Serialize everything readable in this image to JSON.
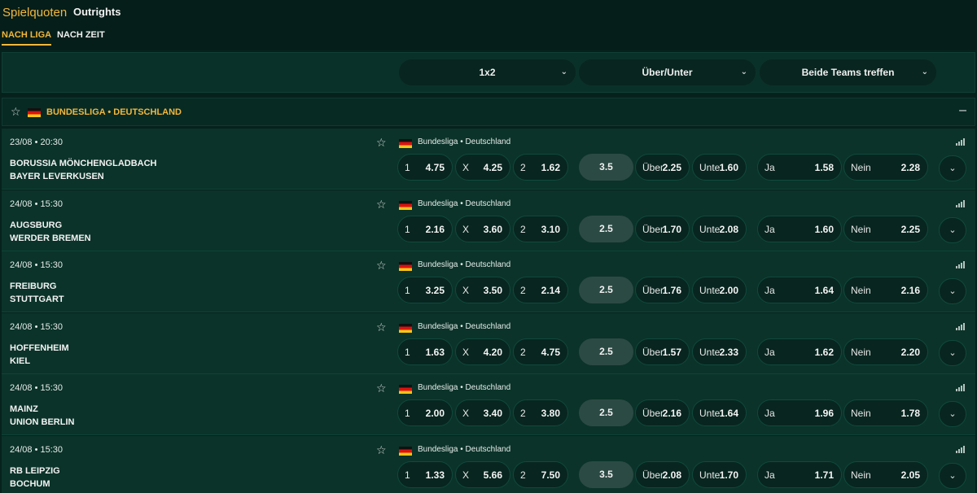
{
  "nav": {
    "tab_odds": "Spielquoten",
    "tab_outrights": "Outrights",
    "sub_by_league": "NACH LIGA",
    "sub_by_time": "NACH ZEIT"
  },
  "markets": [
    {
      "label": "1x2"
    },
    {
      "label": "Über/Unter"
    },
    {
      "label": "Beide Teams treffen"
    }
  ],
  "league": {
    "name": "BUNDESLIGA • DEUTSCHLAND",
    "collapse": "–"
  },
  "labels": {
    "one": "1",
    "x": "X",
    "two": "2",
    "over": "Über",
    "under": "Unte",
    "yes": "Ja",
    "no": "Nein"
  },
  "matches": [
    {
      "date": "23/08 • 20:30",
      "home": "BORUSSIA MÖNCHENGLADBACH",
      "away": "BAYER LEVERKUSEN",
      "league": "Bundesliga • Deutschland",
      "o1": "4.75",
      "ox": "4.25",
      "o2": "1.62",
      "line": "3.5",
      "over": "2.25",
      "under": "1.60",
      "yes": "1.58",
      "no": "2.28"
    },
    {
      "date": "24/08 • 15:30",
      "home": "AUGSBURG",
      "away": "WERDER BREMEN",
      "league": "Bundesliga • Deutschland",
      "o1": "2.16",
      "ox": "3.60",
      "o2": "3.10",
      "line": "2.5",
      "over": "1.70",
      "under": "2.08",
      "yes": "1.60",
      "no": "2.25"
    },
    {
      "date": "24/08 • 15:30",
      "home": "FREIBURG",
      "away": "STUTTGART",
      "league": "Bundesliga • Deutschland",
      "o1": "3.25",
      "ox": "3.50",
      "o2": "2.14",
      "line": "2.5",
      "over": "1.76",
      "under": "2.00",
      "yes": "1.64",
      "no": "2.16"
    },
    {
      "date": "24/08 • 15:30",
      "home": "HOFFENHEIM",
      "away": "KIEL",
      "league": "Bundesliga • Deutschland",
      "o1": "1.63",
      "ox": "4.20",
      "o2": "4.75",
      "line": "2.5",
      "over": "1.57",
      "under": "2.33",
      "yes": "1.62",
      "no": "2.20"
    },
    {
      "date": "24/08 • 15:30",
      "home": "MAINZ",
      "away": "UNION BERLIN",
      "league": "Bundesliga • Deutschland",
      "o1": "2.00",
      "ox": "3.40",
      "o2": "3.80",
      "line": "2.5",
      "over": "2.16",
      "under": "1.64",
      "yes": "1.96",
      "no": "1.78"
    },
    {
      "date": "24/08 • 15:30",
      "home": "RB LEIPZIG",
      "away": "BOCHUM",
      "league": "Bundesliga • Deutschland",
      "o1": "1.33",
      "ox": "5.66",
      "o2": "7.50",
      "line": "3.5",
      "over": "2.08",
      "under": "1.70",
      "yes": "1.71",
      "no": "2.05"
    }
  ],
  "icons": {
    "star": "star-icon",
    "flag": "germany-flag-icon",
    "chevron": "chevron-down-icon",
    "stats": "stats-bars-icon"
  },
  "colors": {
    "accent": "#f3b73d",
    "background": "#06211c",
    "row": "#0b3329"
  }
}
